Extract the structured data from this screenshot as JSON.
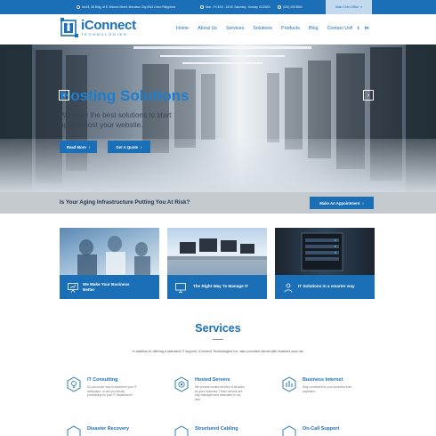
{
  "topbar": {
    "address": "Unit 8, 3D Bldg, M.E. Briones Street, Mandaue City 6014 Cebu Philippines",
    "hours": "Mon - Fri 8:00 - 18:00, Saturday - Sunday CLOSED",
    "phone": "(032) 255 8863",
    "main_button": "Main Cebu Office"
  },
  "logo": {
    "brand": "iConnect",
    "sub": "TECHNOLOGIES"
  },
  "nav": [
    "Home",
    "About Us",
    "Services",
    "Solutions",
    "Products",
    "Blog",
    "Contact Us"
  ],
  "social": {
    "facebook": "f",
    "twitter": "t",
    "linkedin": "in"
  },
  "hero": {
    "title": "Hosting Solutions",
    "subtitle": "We have the best solutions to start up and host your website.",
    "read_more": "Read More",
    "quote": "Get A Quote"
  },
  "risk": {
    "question": "Is Your Aging Infrastructure Putting You At Risk?",
    "button": "Make An Appointment"
  },
  "cards": [
    {
      "label_1": "We Make Your Business",
      "label_2": "Better"
    },
    {
      "label_1": "The Right Way To Manage IT",
      "label_2": ""
    },
    {
      "label_1": "IT Solutions in a smarter way",
      "label_2": ""
    }
  ],
  "services": {
    "title": "Services",
    "intro": "In addition to offering a standard IT support, iConnect Technologies Inc. also provides clients with features such as:",
    "items": [
      {
        "title": "IT Consulting",
        "desc": "Do you know how to transform your IT landscape, or are you blindly purchasing for your IT department?"
      },
      {
        "title": "Hosted Servers",
        "desc": "We provide hosted servers of all sizes for your business. These servers are fully managed and dedicated to our side."
      },
      {
        "title": "Business Internet",
        "desc": "Stay connected to your business from anywhere."
      },
      {
        "title": "Disaster Recovery",
        "desc": ""
      },
      {
        "title": "Structured Cabling",
        "desc": ""
      },
      {
        "title": "On-Call Support",
        "desc": ""
      }
    ]
  },
  "colors": {
    "accent": "#1a6fb6",
    "hero_title": "#1a7fd1",
    "risk_bar": "#c4c9ce"
  }
}
